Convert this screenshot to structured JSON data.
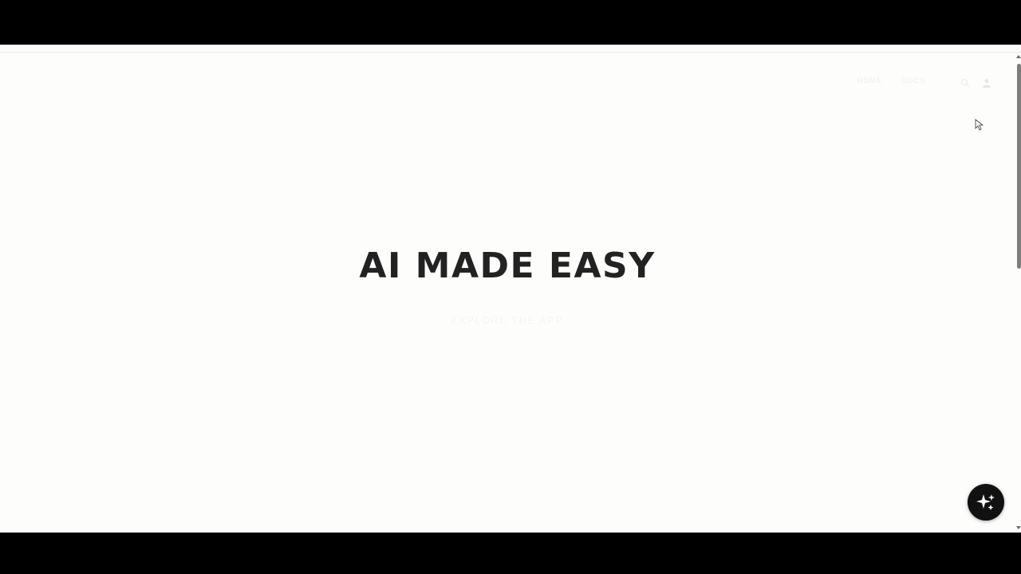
{
  "nav": {
    "links": [
      {
        "label": "HOME"
      },
      {
        "label": "DOCS"
      }
    ],
    "icons": [
      "search-icon",
      "account-icon"
    ]
  },
  "hero": {
    "title": "AI MADE EASY",
    "subtitle": "EXPLORE THE APP"
  },
  "assistant_button": {
    "icon": "sparkles-icon"
  },
  "colors": {
    "page_background": "#fdfdfc",
    "title_text": "#222222",
    "fab_background": "#111111",
    "letterbox": "#000000"
  }
}
